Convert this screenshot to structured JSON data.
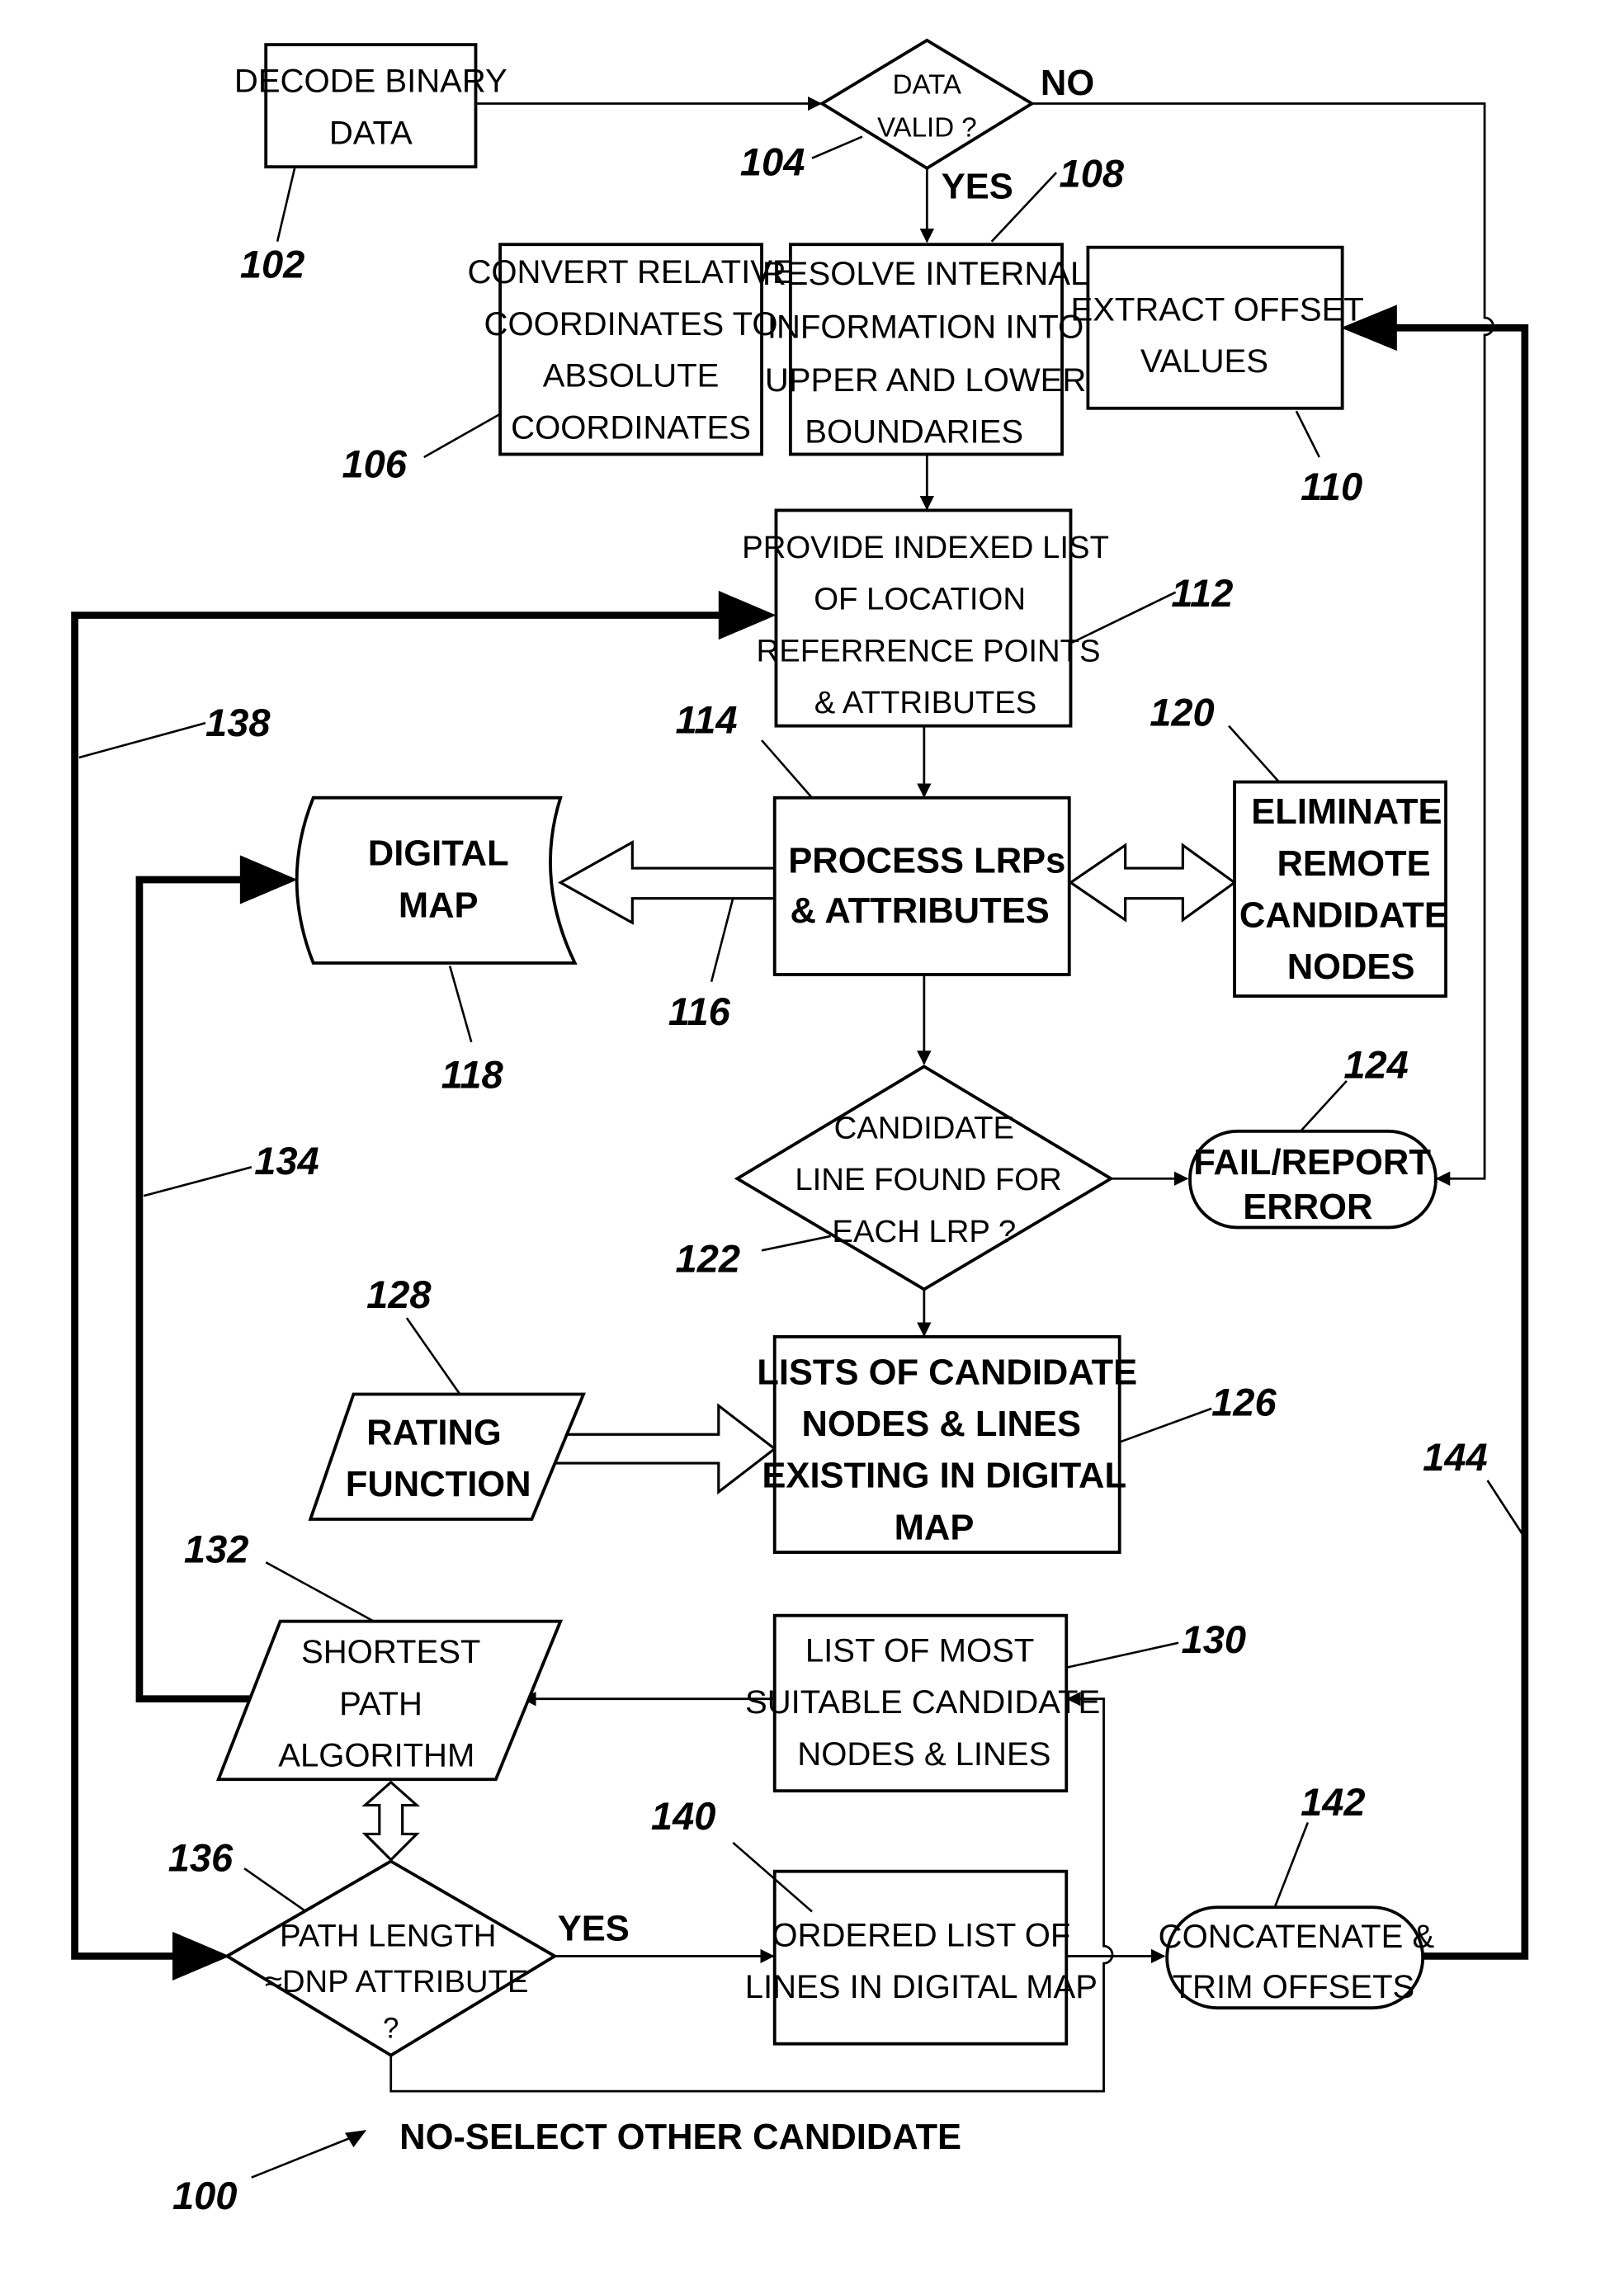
{
  "figure": {
    "reference": "100",
    "nodes": {
      "decode": {
        "ref": "102",
        "lines": [
          "DECODE BINARY",
          "DATA"
        ]
      },
      "data_valid": {
        "ref": "104",
        "lines": [
          "DATA",
          "VALID ?"
        ],
        "yes": "YES",
        "no": "NO"
      },
      "convert": {
        "ref": "106",
        "lines": [
          "CONVERT RELATIVE",
          "COORDINATES TO",
          "ABSOLUTE",
          "COORDINATES"
        ]
      },
      "resolve": {
        "ref": "108",
        "lines": [
          "RESOLVE INTERNAL",
          "INFORMATION INTO",
          "UPPER AND LOWER",
          "BOUNDARIES"
        ]
      },
      "extract": {
        "ref": "110",
        "lines": [
          "EXTRACT OFFSET",
          "VALUES"
        ]
      },
      "provide": {
        "ref": "112",
        "lines": [
          "PROVIDE INDEXED LIST",
          "OF LOCATION",
          "REFERRENCE POINTS",
          "& ATTRIBUTES"
        ]
      },
      "process": {
        "ref": "114",
        "lines": [
          "PROCESS LRPs",
          "& ATTRIBUTES"
        ]
      },
      "link_116": {
        "ref": "116"
      },
      "digital_map": {
        "ref": "118",
        "lines": [
          "DIGITAL",
          "MAP"
        ]
      },
      "eliminate": {
        "ref": "120",
        "lines": [
          "ELIMINATE",
          "REMOTE",
          "CANDIDATE",
          "NODES"
        ]
      },
      "candidate_found": {
        "ref": "122",
        "lines": [
          "CANDIDATE",
          "LINE FOUND FOR",
          "EACH LRP ?"
        ]
      },
      "fail": {
        "ref": "124",
        "lines": [
          "FAIL/REPORT",
          "ERROR"
        ]
      },
      "lists": {
        "ref": "126",
        "lines": [
          "LISTS OF CANDIDATE",
          "NODES & LINES",
          "EXISTING IN DIGITAL",
          "MAP"
        ]
      },
      "rating": {
        "ref": "128",
        "lines": [
          "RATING",
          "FUNCTION"
        ]
      },
      "most_suitable": {
        "ref": "130",
        "lines": [
          "LIST OF MOST",
          "SUITABLE CANDIDATE",
          "NODES & LINES"
        ]
      },
      "shortest": {
        "ref": "132",
        "lines": [
          "SHORTEST",
          "PATH",
          "ALGORITHM"
        ]
      },
      "link_134": {
        "ref": "134"
      },
      "path_length": {
        "ref": "136",
        "lines": [
          "PATH LENGTH",
          "≈DNP ATTRIBUTE",
          "?"
        ],
        "yes": "YES",
        "no": "NO-SELECT OTHER CANDIDATE"
      },
      "link_138": {
        "ref": "138"
      },
      "ordered": {
        "ref": "140",
        "lines": [
          "ORDERED LIST OF",
          "LINES IN DIGITAL MAP"
        ]
      },
      "concat": {
        "ref": "142",
        "lines": [
          "CONCATENATE &",
          "TRIM OFFSETS"
        ]
      },
      "link_144": {
        "ref": "144"
      }
    }
  }
}
